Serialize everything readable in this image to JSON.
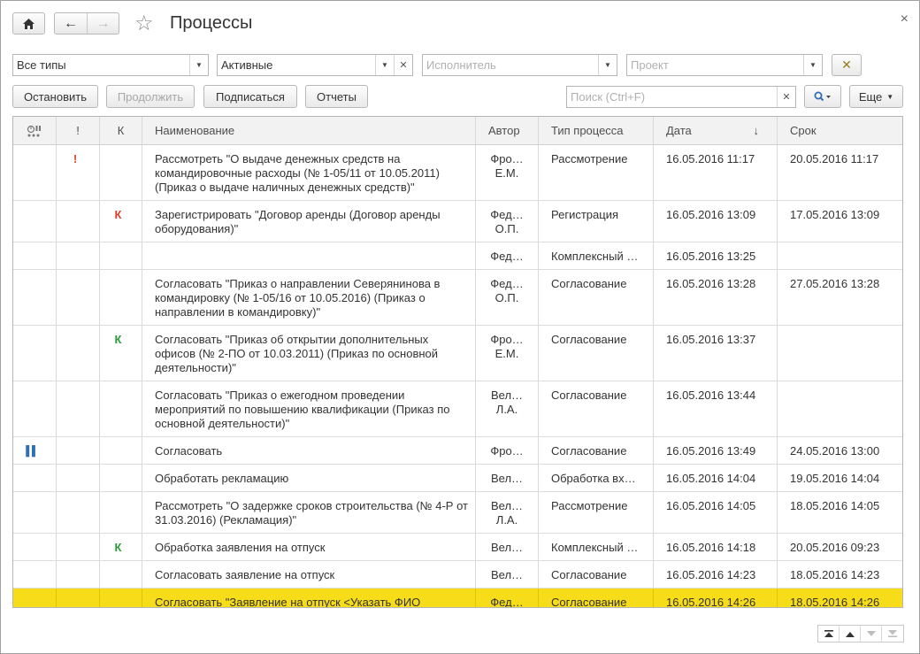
{
  "window": {
    "title": "Процессы",
    "close_glyph": "×"
  },
  "nav": {
    "home_icon": "home-icon",
    "back_glyph": "←",
    "forward_glyph": "→",
    "star_glyph": "☆"
  },
  "filters": {
    "type": {
      "value": "Все типы"
    },
    "state": {
      "value": "Активные"
    },
    "executor": {
      "placeholder": "Исполнитель"
    },
    "project": {
      "placeholder": "Проект"
    },
    "clear_glyph": "✕"
  },
  "toolbar": {
    "stop_label": "Остановить",
    "continue_label": "Продолжить",
    "subscribe_label": "Подписаться",
    "reports_label": "Отчеты",
    "search_placeholder": "Поиск (Ctrl+F)",
    "more_label": "Еще"
  },
  "table": {
    "columns": {
      "state_icon": "state-icon",
      "importance": "!",
      "control": "К",
      "name": "Наименование",
      "author": "Автор",
      "process_type": "Тип процесса",
      "date": "Дата",
      "date_sort": "↓",
      "deadline": "Срок"
    },
    "rows": [
      {
        "state": "",
        "importance": "!",
        "control": "",
        "control_color": "",
        "name": "Рассмотреть \"О выдаче денежных средств на командировочные расходы (№ 1-05/11 от 10.05.2011) (Приказ о выдаче наличных денежных средств)\"",
        "author": "Фро… Е.М.",
        "type": "Рассмотрение",
        "date": "16.05.2016 11:17",
        "deadline": "20.05.2016 11:17",
        "selected": false
      },
      {
        "state": "",
        "importance": "",
        "control": "К",
        "control_color": "#d9412b",
        "name": "Зарегистрировать \"Договор аренды (Договор аренды оборудования)\"",
        "author": "Фед… О.П.",
        "type": "Регистрация",
        "date": "16.05.2016 13:09",
        "deadline": "17.05.2016 13:09",
        "selected": false
      },
      {
        "state": "",
        "importance": "",
        "control": "",
        "control_color": "",
        "name": "",
        "author": "Фед…",
        "type": "Комплексный …",
        "date": "16.05.2016 13:25",
        "deadline": "",
        "selected": false
      },
      {
        "state": "",
        "importance": "",
        "control": "",
        "control_color": "",
        "name": "Согласовать \"Приказ о направлении Северянинова в командировку (№ 1-05/16 от 10.05.2016) (Приказ о направлении в командировку)\"",
        "author": "Фед… О.П.",
        "type": "Согласование",
        "date": "16.05.2016 13:28",
        "deadline": "27.05.2016 13:28",
        "selected": false
      },
      {
        "state": "",
        "importance": "",
        "control": "К",
        "control_color": "#2a9a3a",
        "name": "Согласовать \"Приказ об открытии дополнительных офисов (№ 2-ПО от 10.03.2011) (Приказ по основной деятельности)\"",
        "author": "Фро… Е.М.",
        "type": "Согласование",
        "date": "16.05.2016 13:37",
        "deadline": "",
        "selected": false
      },
      {
        "state": "",
        "importance": "",
        "control": "",
        "control_color": "",
        "name": "Согласовать \"Приказ о ежегодном проведении мероприятий по повышению квалификации (Приказ по основной деятельности)\"",
        "author": "Вел… Л.А.",
        "type": "Согласование",
        "date": "16.05.2016 13:44",
        "deadline": "",
        "selected": false
      },
      {
        "state": "▌▌",
        "importance": "",
        "control": "",
        "control_color": "",
        "name": "Согласовать",
        "author": "Фро…",
        "type": "Согласование",
        "date": "16.05.2016 13:49",
        "deadline": "24.05.2016 13:00",
        "selected": false
      },
      {
        "state": "",
        "importance": "",
        "control": "",
        "control_color": "",
        "name": "Обработать рекламацию",
        "author": "Вел…",
        "type": "Обработка вх…",
        "date": "16.05.2016 14:04",
        "deadline": "19.05.2016 14:04",
        "selected": false
      },
      {
        "state": "",
        "importance": "",
        "control": "",
        "control_color": "",
        "name": "Рассмотреть \"О задержке сроков строительства (№ 4-Р от 31.03.2016) (Рекламация)\"",
        "author": "Вел… Л.А.",
        "type": "Рассмотрение",
        "date": "16.05.2016 14:05",
        "deadline": "18.05.2016 14:05",
        "selected": false
      },
      {
        "state": "",
        "importance": "",
        "control": "К",
        "control_color": "#2a9a3a",
        "name": "Обработка заявления на отпуск",
        "author": "Вел…",
        "type": "Комплексный …",
        "date": "16.05.2016 14:18",
        "deadline": "20.05.2016 09:23",
        "selected": false
      },
      {
        "state": "",
        "importance": "",
        "control": "",
        "control_color": "",
        "name": "Согласовать заявление на отпуск",
        "author": "Вел…",
        "type": "Согласование",
        "date": "16.05.2016 14:23",
        "deadline": "18.05.2016 14:23",
        "selected": false
      },
      {
        "state": "",
        "importance": "",
        "control": "",
        "control_color": "",
        "name": "Согласовать \"Заявление на отпуск <Указать ФИО сотрудника> (Заявление на отпуск)\"",
        "author": "Фед… О.П.",
        "type": "Согласование",
        "date": "16.05.2016 14:26",
        "deadline": "18.05.2016 14:26",
        "selected": true
      }
    ]
  },
  "scroll_nav": {
    "first_glyph": "⏶",
    "up_glyph": "▲",
    "down_glyph": "▼",
    "last_glyph": "⏷"
  },
  "colors": {
    "selection": "#f7dc1a",
    "control_red": "#d9412b",
    "control_green": "#2a9a3a",
    "importance": "#d9412b"
  }
}
